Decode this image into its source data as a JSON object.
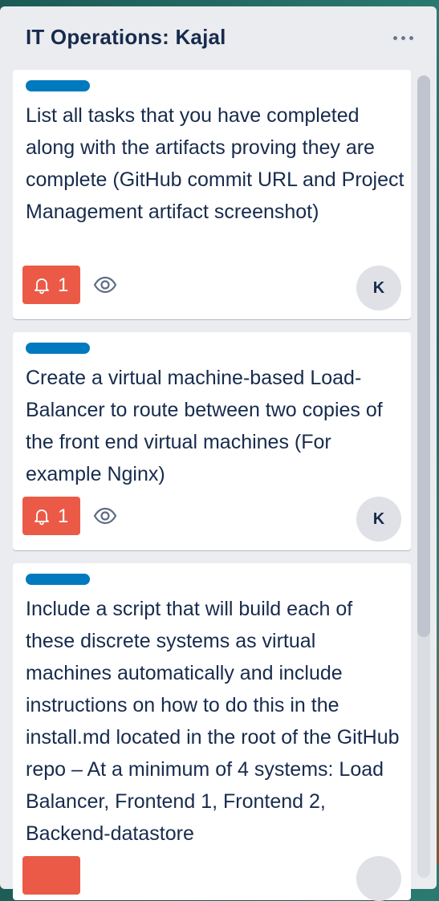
{
  "list": {
    "title": "IT Operations: Kajal",
    "menu_icon": "ellipsis-icon"
  },
  "colors": {
    "label": "#0079bf",
    "notification_badge": "#eb5a46",
    "list_background": "#ebecf0"
  },
  "cards": [
    {
      "title": "List all tasks that you have completed along with the artifacts proving they are complete (GitHub commit URL and Project Management artifact screenshot)",
      "label_color": "blue",
      "notification_count": "1",
      "notification_icon": "bell-icon",
      "watch_icon": "eye-icon",
      "member_initial": "K"
    },
    {
      "title": "Create a virtual machine-based Load-Balancer to route between two copies of the front end virtual machines (For example Nginx)",
      "label_color": "blue",
      "notification_count": "1",
      "notification_icon": "bell-icon",
      "watch_icon": "eye-icon",
      "member_initial": "K"
    },
    {
      "title": "Include a script that will build each of these discrete systems as virtual machines automatically and include instructions on how to do this in the install.md located in the root of the GitHub repo – At a minimum of 4 systems: Load Balancer, Frontend 1, Frontend 2, Backend-datastore",
      "label_color": "blue"
    }
  ]
}
